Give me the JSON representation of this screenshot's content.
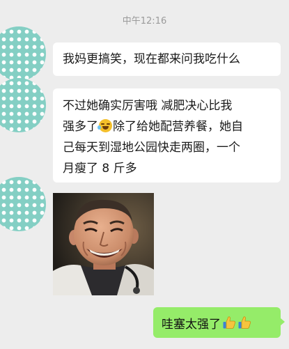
{
  "status": {
    "timestamp": "中午12:16"
  },
  "messages": [
    {
      "sender": "friend",
      "text": "我妈更搞笑，现在都来问我吃什么"
    },
    {
      "sender": "friend",
      "lines": [
        "不过她确实厉害哦 减肥决心比我",
        "强多了",
        "除了给她配营养餐，她自",
        "己每天到湿地公园快走两圈，一个",
        "月瘦了 8 斤多"
      ],
      "emoji": "crying-laughing-emoji"
    },
    {
      "sender": "friend",
      "type": "image",
      "icon": "laughing-man-meme"
    },
    {
      "sender": "me",
      "text": "哇塞太强了",
      "emojis": [
        "thumbs-up-emoji",
        "thumbs-up-emoji"
      ]
    }
  ],
  "colors": {
    "background": "#ededed",
    "received_bubble": "#ffffff",
    "sent_bubble": "#95ec69",
    "avatar": "#84cfc4"
  }
}
